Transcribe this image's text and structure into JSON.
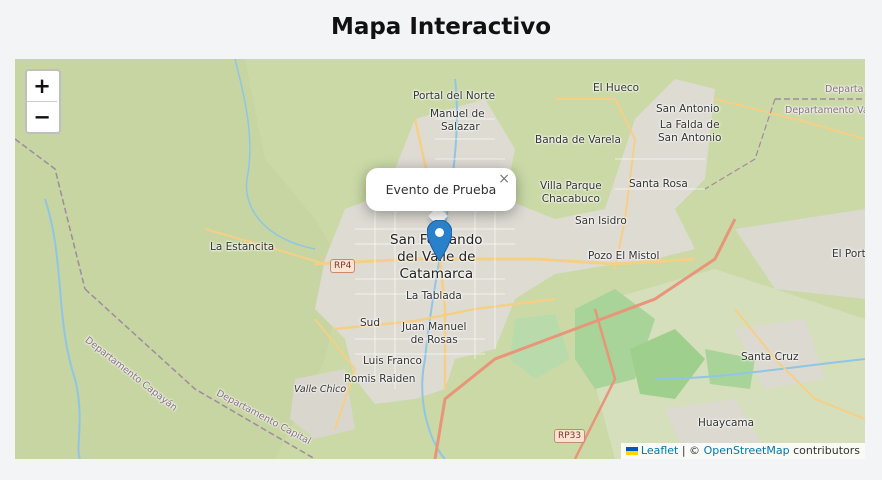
{
  "page": {
    "title": "Mapa Interactivo"
  },
  "zoom": {
    "in_label": "+",
    "out_label": "−"
  },
  "popup": {
    "text": "Evento de Prueba",
    "close_label": "×"
  },
  "attribution": {
    "leaflet_label": "Leaflet",
    "separator": "| ©",
    "osm_label": "OpenStreetMap",
    "suffix": "contributors"
  },
  "map_labels": {
    "portal_del_norte": "Portal del Norte",
    "manuel_de_salazar_1": "Manuel de",
    "manuel_de_salazar_2": "Salazar",
    "el_hueco": "El Hueco",
    "san_antonio": "San Antonio",
    "la_falda_1": "La Falda de",
    "la_falda_2": "San Antonio",
    "banda_de_varela": "Banda de Varela",
    "villa_parque_1": "Villa Parque",
    "villa_parque_2": "Chacabuco",
    "santa_rosa": "Santa Rosa",
    "san_isidro": "San Isidro",
    "pozo_el_mistol": "Pozo El Mistol",
    "la_estancita": "La Estancita",
    "city_1": "San Fernando",
    "city_2": "del Valle de",
    "city_3": "Catamarca",
    "la_tablada": "La Tablada",
    "sud": "Sud",
    "juan_manuel_1": "Juan Manuel",
    "juan_manuel_2": "de Rosas",
    "luis_franco": "Luis Franco",
    "romis_raiden": "Romis Raiden",
    "valle_chico": "Valle Chico",
    "santa_cruz": "Santa Cruz",
    "huaycama": "Huaycama",
    "el_portezuelo": "El Porte",
    "departamento_top": "Departa",
    "departamento_top2": "Departamento Va",
    "dept_capayan": "Departamento Capayán",
    "dept_capital": "Departamento Capital",
    "rp4": "RP4",
    "rp33": "RP33"
  },
  "colors": {
    "marker": "#2a81cb",
    "marker_dark": "#1b5d97",
    "highway": "#e8957a",
    "primary_road": "#f9d48a",
    "urban": "#e0ddd6",
    "forest": "#a9d597",
    "water": "#8fc6e6"
  },
  "icons": {
    "marker": "map-pin-icon",
    "close": "close-icon",
    "flag": "ukraine-flag-icon"
  }
}
